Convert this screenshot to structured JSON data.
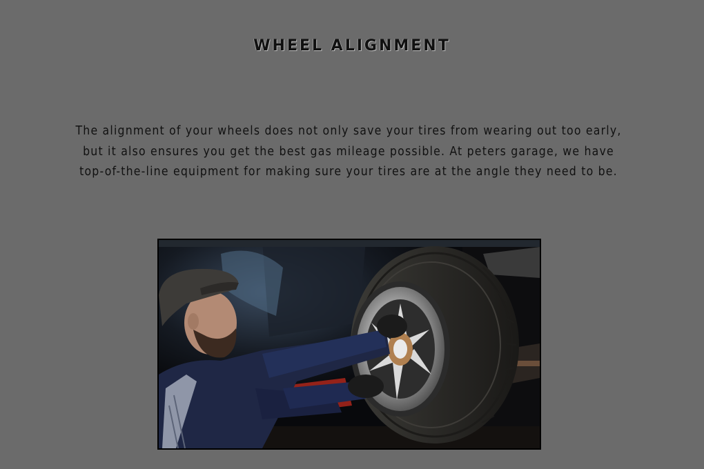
{
  "section": {
    "title": "WHEEL ALIGNMENT",
    "description": "The alignment of your wheels does not only save your tires from wearing out too early, but it also ensures you get the best gas mileage possible. At peters garage, we have top-of-the-line equipment for making sure your tires are at the angle they need to be."
  },
  "colors": {
    "background": "#6b6b6b",
    "text": "#111111"
  },
  "image": {
    "subject": "mechanic-working-on-car-wheel"
  }
}
